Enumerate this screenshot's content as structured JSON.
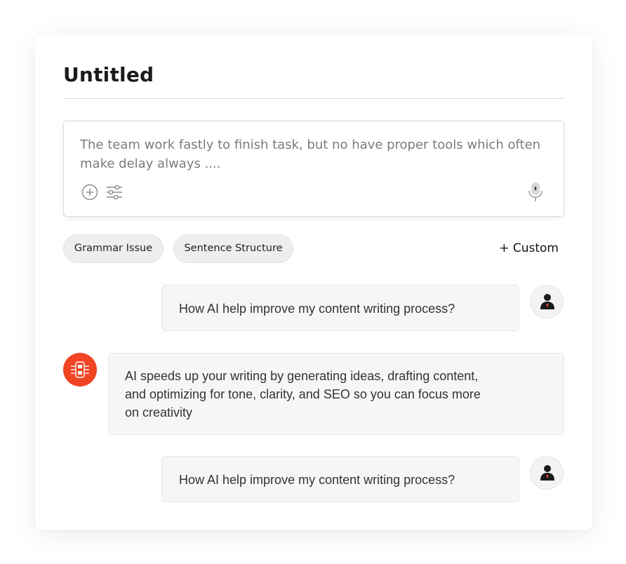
{
  "document": {
    "title": "Untitled"
  },
  "composer": {
    "text": "The team work fastly to finish task, but no have proper tools which often make delay always ....",
    "add_icon": "plus-circle-icon",
    "settings_icon": "sliders-icon",
    "mic_icon": "microphone-icon"
  },
  "chips": [
    {
      "label": "Grammar Issue"
    },
    {
      "label": "Sentence Structure"
    }
  ],
  "custom": {
    "label": "+ Custom"
  },
  "messages": [
    {
      "role": "user",
      "text": "How AI help improve my content writing process?"
    },
    {
      "role": "assistant",
      "lines": [
        "AI speeds up your writing by generating ideas, drafting content,",
        "and optimizing for tone, clarity, and SEO so you can focus more",
        "on creativity"
      ]
    },
    {
      "role": "user",
      "text": "How AI help improve my content writing process?"
    }
  ],
  "colors": {
    "accent": "#f14424",
    "user_icon": "#1b1b1b",
    "bubble_bg": "#f6f6f6"
  }
}
